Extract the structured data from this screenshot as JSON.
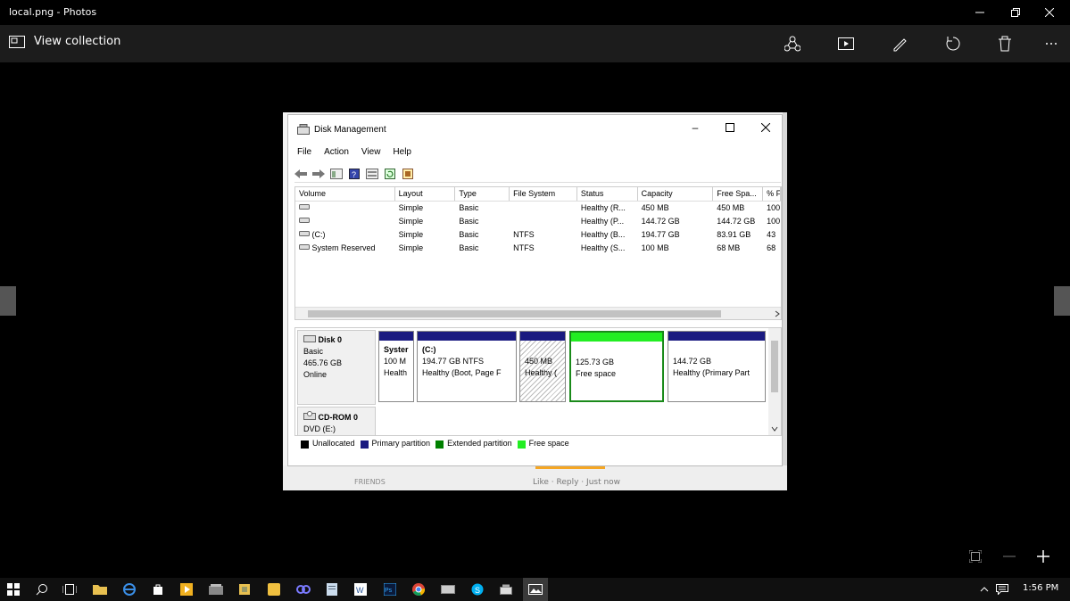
{
  "window": {
    "title": "local.png - Photos"
  },
  "toolbar": {
    "view_collection": "View collection"
  },
  "dm": {
    "title": "Disk Management",
    "menu": [
      "File",
      "Action",
      "View",
      "Help"
    ],
    "columns": [
      "Volume",
      "Layout",
      "Type",
      "File System",
      "Status",
      "Capacity",
      "Free Spa...",
      "% F"
    ],
    "rows": [
      {
        "volume": "",
        "layout": "Simple",
        "type": "Basic",
        "fs": "",
        "status": "Healthy (R...",
        "capacity": "450 MB",
        "free": "450 MB",
        "pct": "100"
      },
      {
        "volume": "",
        "layout": "Simple",
        "type": "Basic",
        "fs": "",
        "status": "Healthy (P...",
        "capacity": "144.72 GB",
        "free": "144.72 GB",
        "pct": "100"
      },
      {
        "volume": "(C:)",
        "layout": "Simple",
        "type": "Basic",
        "fs": "NTFS",
        "status": "Healthy (B...",
        "capacity": "194.77 GB",
        "free": "83.91 GB",
        "pct": "43"
      },
      {
        "volume": "System Reserved",
        "layout": "Simple",
        "type": "Basic",
        "fs": "NTFS",
        "status": "Healthy (S...",
        "capacity": "100 MB",
        "free": "68 MB",
        "pct": "68"
      }
    ],
    "disk0": {
      "name": "Disk 0",
      "type": "Basic",
      "size": "465.76 GB",
      "state": "Online"
    },
    "partitions": [
      {
        "title": "Syster",
        "size": "100 M",
        "status": "Health"
      },
      {
        "title": "(C:)",
        "size": "194.77 GB NTFS",
        "status": "Healthy (Boot, Page F"
      },
      {
        "title": "",
        "size": "450 MB",
        "status": "Healthy ("
      },
      {
        "title": "",
        "size": "125.73 GB",
        "status": "Free space"
      },
      {
        "title": "",
        "size": "144.72 GB",
        "status": "Healthy (Primary Part"
      }
    ],
    "cdrom": {
      "name": "CD-ROM 0",
      "drive": "DVD (E:)"
    },
    "legend": [
      {
        "label": "Unallocated",
        "color": "#000000"
      },
      {
        "label": "Primary partition",
        "color": "#1a1a80"
      },
      {
        "label": "Extended partition",
        "color": "#008000"
      },
      {
        "label": "Free space",
        "color": "#22ee22"
      }
    ]
  },
  "behind": {
    "friends": "FRIENDS",
    "like_row": "Like · Reply · Just now"
  },
  "taskbar": {
    "clock": "1:56 PM"
  }
}
